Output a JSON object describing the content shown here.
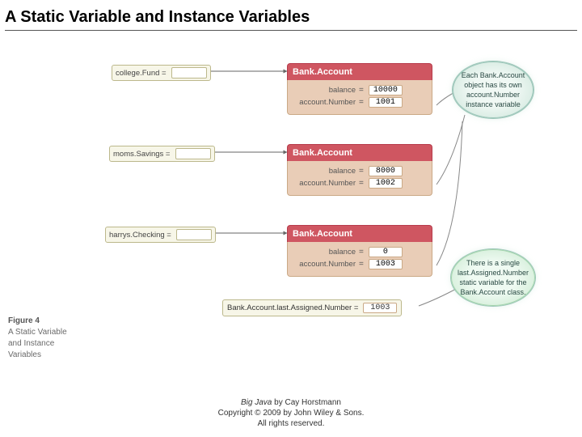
{
  "title": "A Static Variable and Instance Variables",
  "class_name": "Bank.Account",
  "vars": [
    {
      "label": "college.Fund ="
    },
    {
      "label": "moms.Savings ="
    },
    {
      "label": "harrys.Checking ="
    }
  ],
  "fields": {
    "balance_label": "balance",
    "account_label": "account.Number",
    "eq": "="
  },
  "objects": [
    {
      "balance": "10000",
      "account": "1001"
    },
    {
      "balance": "8000",
      "account": "1002"
    },
    {
      "balance": "0",
      "account": "1003"
    }
  ],
  "static_var": {
    "label": "Bank.Account.last.Assigned.Number =",
    "value": "1003"
  },
  "callouts": {
    "instance": "Each Bank.Account object has its own account.Number instance variable",
    "static": "There is a single last.Assigned.Number static variable for the Bank.Account class."
  },
  "figure": {
    "num": "Figure 4",
    "caption_l1": "A Static Variable",
    "caption_l2": "and Instance",
    "caption_l3": "Variables"
  },
  "footer": {
    "book": "Big Java",
    "by": " by Cay Horstmann",
    "copy": "Copyright © 2009 by John Wiley & Sons.",
    "rights": "All rights reserved."
  }
}
